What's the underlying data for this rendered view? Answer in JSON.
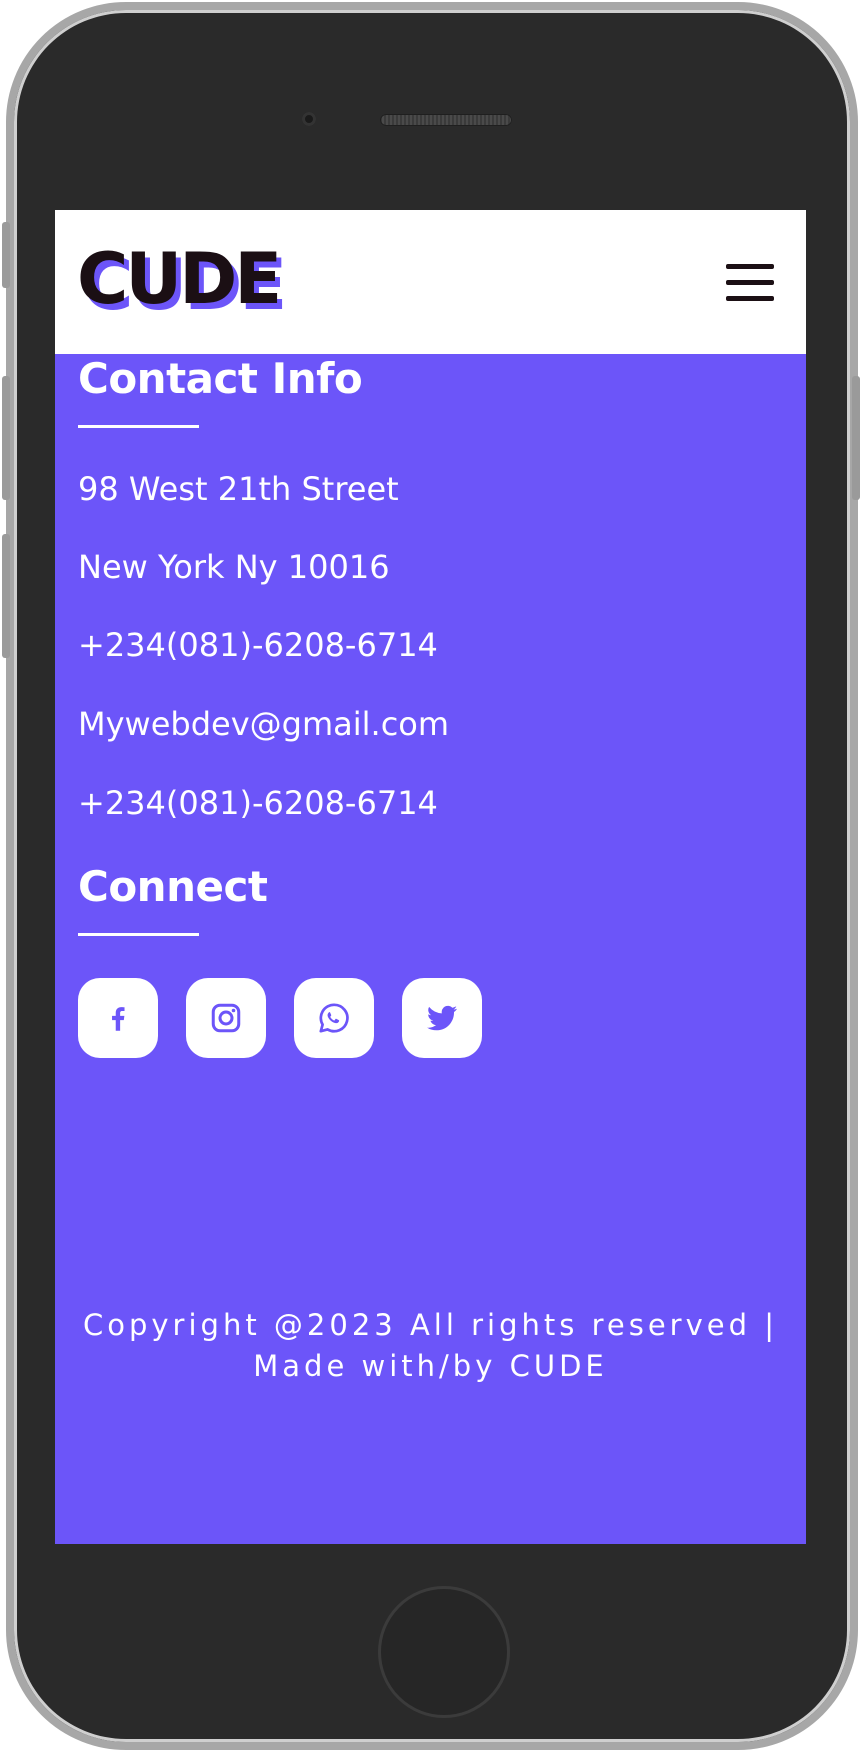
{
  "brand": {
    "logo_text": "CUDE",
    "accent_color": "#6c55f9",
    "dark_color": "#1b0f14"
  },
  "navbar": {
    "menu_icon": "hamburger-menu-icon"
  },
  "contact": {
    "heading": "Contact Info",
    "lines": [
      "98 West 21th Street",
      "New York Ny 10016",
      "+234(081)-6208-6714",
      "Mywebdev@gmail.com",
      "+234(081)-6208-6714"
    ]
  },
  "connect": {
    "heading": "Connect",
    "icons": [
      "facebook-icon",
      "instagram-icon",
      "whatsapp-icon",
      "twitter-icon"
    ]
  },
  "footer": {
    "line1": "Copyright @2023 All rights reserved |",
    "line2": "Made with/by CUDE"
  }
}
